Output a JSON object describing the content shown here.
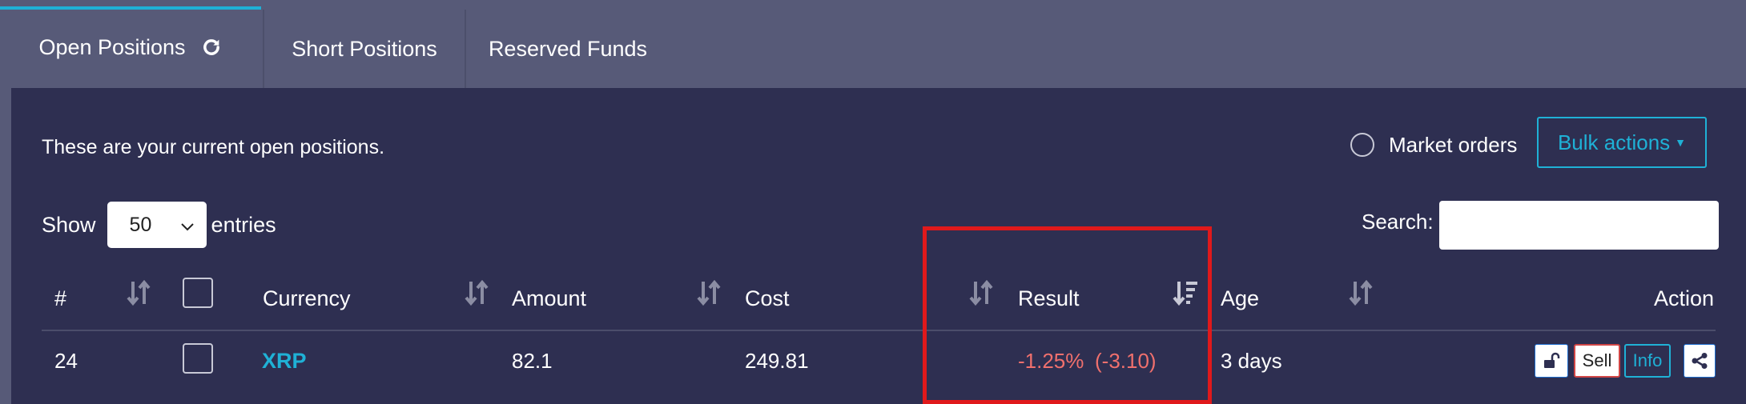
{
  "tabs": [
    {
      "label": "Open Positions",
      "active": true
    },
    {
      "label": "Short Positions",
      "active": false
    },
    {
      "label": "Reserved Funds",
      "active": false
    }
  ],
  "intro_text": "These are your current open positions.",
  "market_orders_label": "Market orders",
  "bulk_actions_label": "Bulk actions",
  "length": {
    "show_label": "Show",
    "value": "50",
    "entries_label": "entries"
  },
  "search": {
    "label": "Search:",
    "value": ""
  },
  "columns": {
    "num": "#",
    "currency": "Currency",
    "amount": "Amount",
    "cost": "Cost",
    "result": "Result",
    "age": "Age",
    "action": "Action"
  },
  "rows": [
    {
      "num": "24",
      "currency": "XRP",
      "amount": "82.1",
      "cost": "249.81",
      "result_pct": "-1.25%",
      "result_abs": "(-3.10)",
      "age": "3 days",
      "actions": {
        "sell": "Sell",
        "info": "Info"
      }
    }
  ],
  "icons": [
    "refresh-icon",
    "sort-icon",
    "sort-desc-icon",
    "unlock-icon",
    "share-icon",
    "chevron-down-icon",
    "caret-down-icon"
  ],
  "colors": {
    "accent": "#1fb1d6",
    "negative": "#f0706d",
    "panel": "#2e2f51",
    "header": "#575a78",
    "highlight": "#e0191b"
  }
}
